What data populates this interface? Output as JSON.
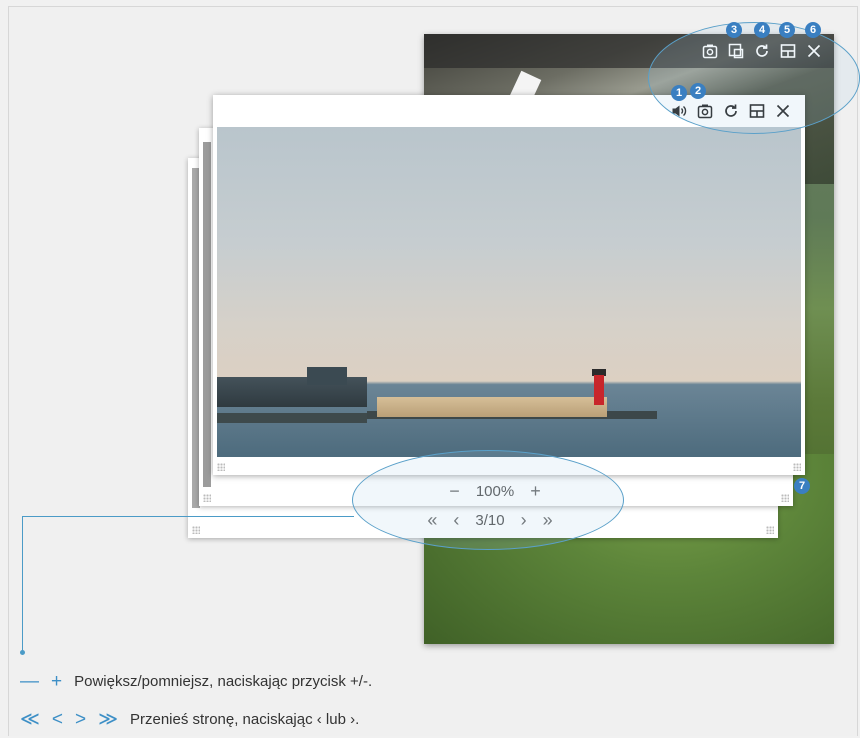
{
  "front_window": {
    "zoom": {
      "minus": "−",
      "value": "100%",
      "plus": "+"
    },
    "nav": {
      "first": "«",
      "prev": "‹",
      "page": "3/10",
      "next": "›",
      "last": "»"
    }
  },
  "badges": [
    "1",
    "2",
    "3",
    "4",
    "5",
    "6",
    "7"
  ],
  "legend": {
    "zoom_minus": "—",
    "zoom_plus": "+",
    "zoom_text": "Powiększ/pomniejsz, naciskając przycisk +/-.",
    "nav_first": "≪",
    "nav_prev": "<",
    "nav_next": ">",
    "nav_last": "≫",
    "nav_text": "Przenieś stronę, naciskając ‹ lub ›."
  },
  "colors": {
    "accent": "#3a7fc1",
    "callout": "#5aa0c9",
    "lighthouse": "#c8262b"
  },
  "icons": [
    "speaker-icon",
    "camera-icon",
    "crop-icon",
    "refresh-icon",
    "layout-icon",
    "close-icon"
  ]
}
